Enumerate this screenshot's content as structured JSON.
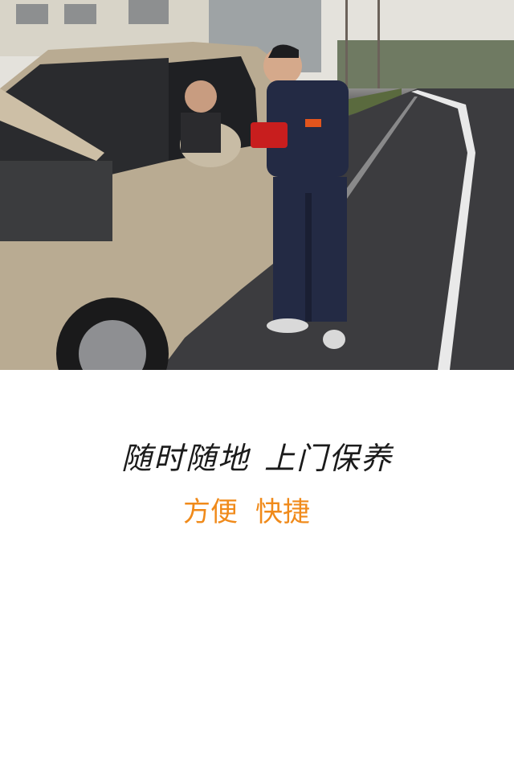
{
  "hero": {
    "image_icon": "roadside-car-service-photo"
  },
  "slogan": {
    "part1": "随时随地",
    "part2": "上门保养"
  },
  "tagline": {
    "part1": "方便",
    "part2": "快捷",
    "color": "#f08a1a"
  },
  "colors": {
    "background": "#ffffff",
    "slogan_text": "#1b1b1b",
    "accent": "#f08a1a"
  }
}
